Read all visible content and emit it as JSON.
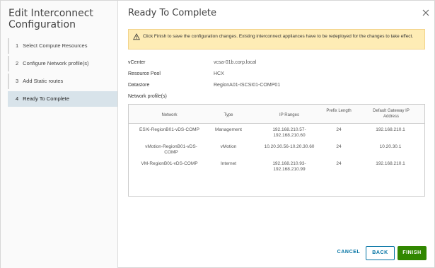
{
  "sidebar": {
    "title": "Edit Interconnect Configuration",
    "steps": [
      {
        "num": "1",
        "label": "Select Compute Resources"
      },
      {
        "num": "2",
        "label": "Configure Network profile(s)"
      },
      {
        "num": "3",
        "label": "Add Static routes"
      },
      {
        "num": "4",
        "label": "Ready To Complete"
      }
    ]
  },
  "main": {
    "title": "Ready To Complete",
    "alert": "Click Finish to save the configuration changes. Existing interconnect appliances have to be redeployed for the changes to take effect.",
    "properties": [
      {
        "label": "vCenter",
        "value": "vcsa-01b.corp.local"
      },
      {
        "label": "Resource Pool",
        "value": "HCX"
      },
      {
        "label": "Datastore",
        "value": "RegionA01-ISCSI01-COMP01"
      },
      {
        "label": "Network profile(s)",
        "value": ""
      }
    ],
    "table": {
      "headers": [
        "Network",
        "Type",
        "IP Ranges",
        "Prefix Length",
        "Default Gateway IP Address"
      ],
      "rows": [
        [
          "ESXi-RegionB01-vDS-COMP",
          "Management",
          "192.168.210.57-192.168.210.60",
          "24",
          "192.168.210.1"
        ],
        [
          "vMotion-RegionB01-vDS-COMP",
          "vMotion",
          "10.20.30.56-10.20.30.60",
          "24",
          "10.20.30.1"
        ],
        [
          "VM-RegionB01-vDS-COMP",
          "Internet",
          "192.168.210.93-192.168.210.99",
          "24",
          "192.168.210.1"
        ]
      ]
    }
  },
  "footer": {
    "cancel": "CANCEL",
    "back": "BACK",
    "finish": "FINISH"
  },
  "icons": {
    "close": "close-icon",
    "warning": "warning-icon"
  },
  "colors": {
    "active_step_bg": "#d8e3ea",
    "alert_bg": "#feecb5",
    "primary_link": "#0072a3",
    "finish_bg": "#318700"
  }
}
